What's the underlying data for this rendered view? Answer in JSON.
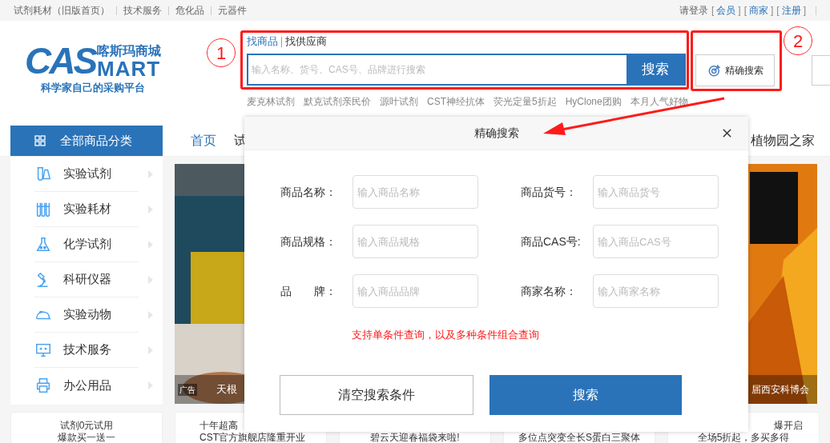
{
  "top_bar": {
    "left_links": [
      "试剂耗材（旧版首页）",
      "技术服务",
      "危化品",
      "元器件"
    ],
    "login_text": "请登录",
    "right_links": [
      {
        "open": "[",
        "label": "会员",
        "close": "]"
      },
      {
        "open": "[",
        "label": "商家",
        "close": "]"
      },
      {
        "open": "[",
        "label": "注册",
        "close": "]"
      }
    ]
  },
  "logo": {
    "letters_top": "CAS",
    "letters_bottom": "MART",
    "name": "喀斯玛商城",
    "slogan": "科学家自己的采购平台"
  },
  "search": {
    "tabs": [
      {
        "label": "找商品",
        "selected": true
      },
      {
        "label": "找供应商",
        "selected": false
      }
    ],
    "placeholder": "输入名称、货号、CAS号、品牌进行搜索",
    "button": "搜索",
    "hot_words": [
      "麦克林试剂",
      "默克试剂亲民价",
      "源叶试剂",
      "CST神经抗体",
      "荧光定量5折起",
      "HyClone团购",
      "本月人气好物"
    ],
    "precise_button": "精确搜索"
  },
  "annotations": [
    "1",
    "2"
  ],
  "nav": {
    "category_button": "全部商品分类",
    "items": [
      {
        "label": "首页",
        "selected": true
      },
      {
        "label": "试",
        "selected": false
      },
      {
        "label": "植物园之家",
        "selected": false
      }
    ]
  },
  "categories": [
    {
      "label": "实验试剂",
      "kind": "flask"
    },
    {
      "label": "实验耗材",
      "kind": "tubes"
    },
    {
      "label": "化学试剂",
      "kind": "beaker"
    },
    {
      "label": "科研仪器",
      "kind": "microscope"
    },
    {
      "label": "实验动物",
      "kind": "mouse"
    },
    {
      "label": "技术服务",
      "kind": "monitor"
    },
    {
      "label": "办公用品",
      "kind": "printer"
    }
  ],
  "banner": {
    "ad_tag": "广告",
    "left_caption": "天根",
    "right_caption": "届西安科博会"
  },
  "promo_cards": [
    {
      "lines": [
        "试剂0元试用",
        "爆款买一送一"
      ]
    },
    {
      "lines": [
        "十年超高",
        "CST官方旗舰店隆重开业"
      ]
    },
    {
      "lines": [
        "碧云天迎春福袋来啦!"
      ]
    },
    {
      "lines": [
        "多位点突变全长S蛋白三聚体"
      ]
    },
    {
      "lines": [
        "爆开启",
        "全场5折起，多买多得"
      ]
    }
  ],
  "modal": {
    "title": "精确搜索",
    "fields": [
      {
        "label": "商品名称：",
        "placeholder": "输入商品名称"
      },
      {
        "label": "商品货号：",
        "placeholder": "输入商品货号"
      },
      {
        "label": "商品规格：",
        "placeholder": "输入商品规格"
      },
      {
        "label": "商品CAS号:",
        "placeholder": "输入商品CAS号"
      },
      {
        "label": "品　　牌：",
        "placeholder": "输入商品品牌"
      },
      {
        "label": "商家名称：",
        "placeholder": "输入商家名称"
      }
    ],
    "note": "支持单条件查询，以及多种条件组合查询",
    "buttons": [
      {
        "label": "清空搜索条件",
        "kind": "secondary"
      },
      {
        "label": "搜索",
        "kind": "primary"
      }
    ]
  }
}
